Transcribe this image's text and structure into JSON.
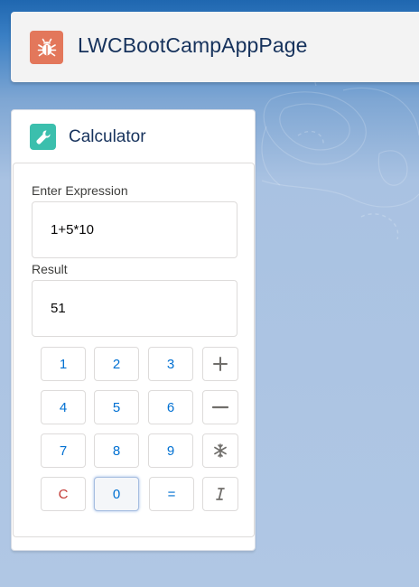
{
  "header": {
    "title": "LWCBootCampAppPage",
    "icon": "bug-icon",
    "icon_color": "#e3775b"
  },
  "card": {
    "title": "Calculator",
    "icon": "wrench-icon",
    "icon_color": "#3bbfad"
  },
  "expression": {
    "label": "Enter Expression",
    "value": "1+5*10"
  },
  "result": {
    "label": "Result",
    "value": "51"
  },
  "keypad": {
    "k1": "1",
    "k2": "2",
    "k3": "3",
    "k4": "4",
    "k5": "5",
    "k6": "6",
    "k7": "7",
    "k8": "8",
    "k9": "9",
    "clear": "C",
    "k0": "0",
    "equals": "=",
    "plus_icon": "plus-icon",
    "minus_icon": "minus-icon",
    "multiply_icon": "snowflake-icon",
    "divide_icon": "italic-i-icon"
  },
  "colors": {
    "accent": "#0070d2",
    "clear": "#c23934"
  }
}
